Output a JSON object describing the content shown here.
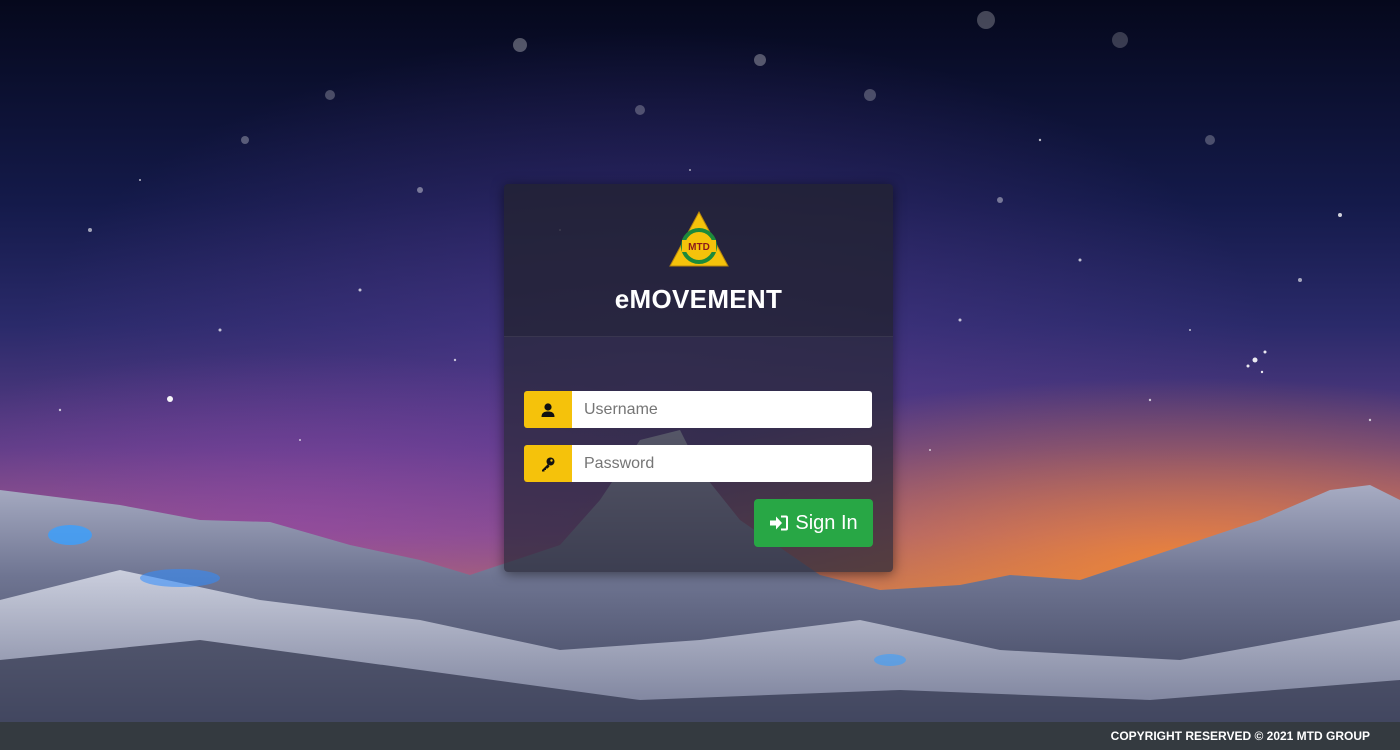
{
  "app": {
    "brand": "eMOVEMENT",
    "logo_text": "MTD"
  },
  "login": {
    "username_placeholder": "Username",
    "password_placeholder": "Password",
    "signin_label": "Sign In"
  },
  "footer": {
    "text": "COPYRIGHT RESERVED © 2021 MTD GROUP"
  },
  "icons": {
    "username": "user-icon",
    "password": "key-icon",
    "signin": "sign-in-icon"
  },
  "colors": {
    "addon": "#f5c20b",
    "signin_button": "#28a745",
    "footer_bg": "#343a40",
    "panel_bg": "rgba(40,40,55,0.72)"
  }
}
